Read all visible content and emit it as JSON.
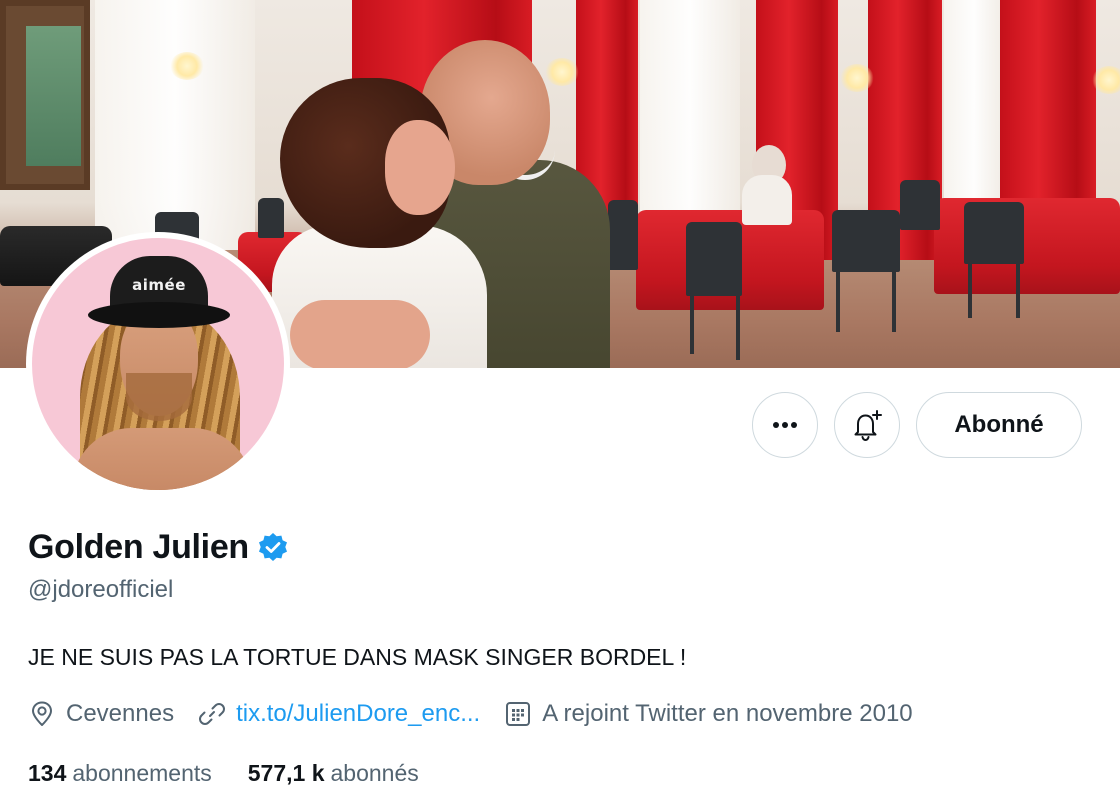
{
  "profile": {
    "display_name": "Golden Julien",
    "verified": true,
    "handle": "@jdoreofficiel",
    "bio": "JE NE SUIS PAS LA TORTUE DANS MASK SINGER BORDEL !",
    "location": "Cevennes",
    "website": "tix.to/JulienDore_enc...",
    "joined": "A rejoint Twitter en novembre 2010",
    "avatar_hat_text": "aimée"
  },
  "stats": {
    "following_count": "134",
    "following_label": "abonnements",
    "followers_count": "577,1 k",
    "followers_label": "abonnés"
  },
  "actions": {
    "more_label": "•••",
    "follow_label": "Abonné"
  },
  "icons": {
    "verified": "verified-badge-icon",
    "location": "location-pin-icon",
    "link": "link-icon",
    "calendar": "calendar-icon",
    "bell": "bell-plus-icon",
    "more": "more-dots-icon"
  },
  "colors": {
    "accent": "#1d9bf0",
    "text_primary": "#0f1419",
    "text_secondary": "#536471",
    "border": "#cfd9de",
    "avatar_bg": "#f7c8d6",
    "curtain_red": "#d81c24"
  }
}
